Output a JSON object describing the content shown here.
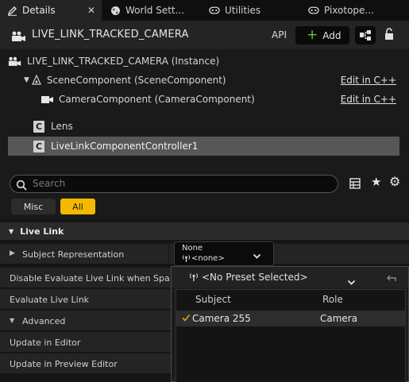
{
  "tabs": [
    {
      "label": "Details",
      "icon": "pencil-icon",
      "active": true,
      "close": "✕"
    },
    {
      "label": "World Sett...",
      "icon": "globe-icon",
      "active": false
    },
    {
      "label": "Utilities",
      "icon": "gamepad-icon",
      "active": false
    },
    {
      "label": "Pixotope...",
      "icon": "gamepad-icon",
      "active": false
    }
  ],
  "header": {
    "title": "LIVE_LINK_TRACKED_CAMERA",
    "api_label": "API",
    "add_label": "Add"
  },
  "tree": {
    "instance": "LIVE_LINK_TRACKED_CAMERA (Instance)",
    "scene_component": "SceneComponent (SceneComponent)",
    "camera_component": "CameraComponent (CameraComponent)",
    "edit_cpp_1": "Edit in C++",
    "edit_cpp_2": "Edit in C++",
    "lens": "Lens",
    "controller": "LiveLinkComponentController1"
  },
  "search": {
    "placeholder": "Search"
  },
  "filters": {
    "misc": "Misc",
    "all": "All"
  },
  "category": {
    "live_link": "Live Link"
  },
  "properties": {
    "subject_representation": "Subject Representation",
    "disable_evaluate": "Disable Evaluate Live Link when Spa...",
    "evaluate": "Evaluate Live Link",
    "advanced": "Advanced",
    "update_in_editor": "Update in Editor",
    "update_in_preview": "Update in Preview Editor"
  },
  "subject_select": {
    "value": "None",
    "sub": "<none>"
  },
  "popup": {
    "preset": "<No Preset Selected>",
    "col_subject": "Subject",
    "col_role": "Role",
    "rows": [
      {
        "subject": "Camera 255",
        "role": "Camera",
        "checked": true
      }
    ]
  },
  "colors": {
    "accent": "#f5b800",
    "add_plus": "#63c745",
    "selection": "#575757"
  }
}
